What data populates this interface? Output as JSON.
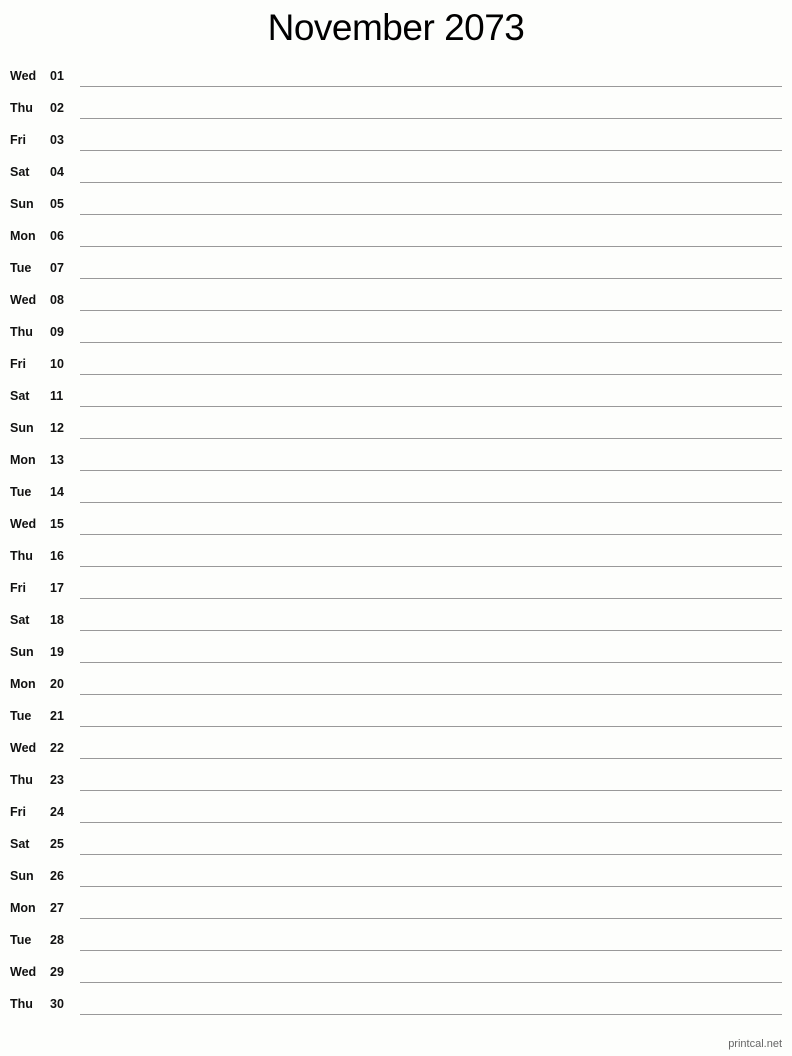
{
  "title": "November 2073",
  "days": [
    {
      "dow": "Wed",
      "day": "01"
    },
    {
      "dow": "Thu",
      "day": "02"
    },
    {
      "dow": "Fri",
      "day": "03"
    },
    {
      "dow": "Sat",
      "day": "04"
    },
    {
      "dow": "Sun",
      "day": "05"
    },
    {
      "dow": "Mon",
      "day": "06"
    },
    {
      "dow": "Tue",
      "day": "07"
    },
    {
      "dow": "Wed",
      "day": "08"
    },
    {
      "dow": "Thu",
      "day": "09"
    },
    {
      "dow": "Fri",
      "day": "10"
    },
    {
      "dow": "Sat",
      "day": "11"
    },
    {
      "dow": "Sun",
      "day": "12"
    },
    {
      "dow": "Mon",
      "day": "13"
    },
    {
      "dow": "Tue",
      "day": "14"
    },
    {
      "dow": "Wed",
      "day": "15"
    },
    {
      "dow": "Thu",
      "day": "16"
    },
    {
      "dow": "Fri",
      "day": "17"
    },
    {
      "dow": "Sat",
      "day": "18"
    },
    {
      "dow": "Sun",
      "day": "19"
    },
    {
      "dow": "Mon",
      "day": "20"
    },
    {
      "dow": "Tue",
      "day": "21"
    },
    {
      "dow": "Wed",
      "day": "22"
    },
    {
      "dow": "Thu",
      "day": "23"
    },
    {
      "dow": "Fri",
      "day": "24"
    },
    {
      "dow": "Sat",
      "day": "25"
    },
    {
      "dow": "Sun",
      "day": "26"
    },
    {
      "dow": "Mon",
      "day": "27"
    },
    {
      "dow": "Tue",
      "day": "28"
    },
    {
      "dow": "Wed",
      "day": "29"
    },
    {
      "dow": "Thu",
      "day": "30"
    }
  ],
  "footer": "printcal.net"
}
